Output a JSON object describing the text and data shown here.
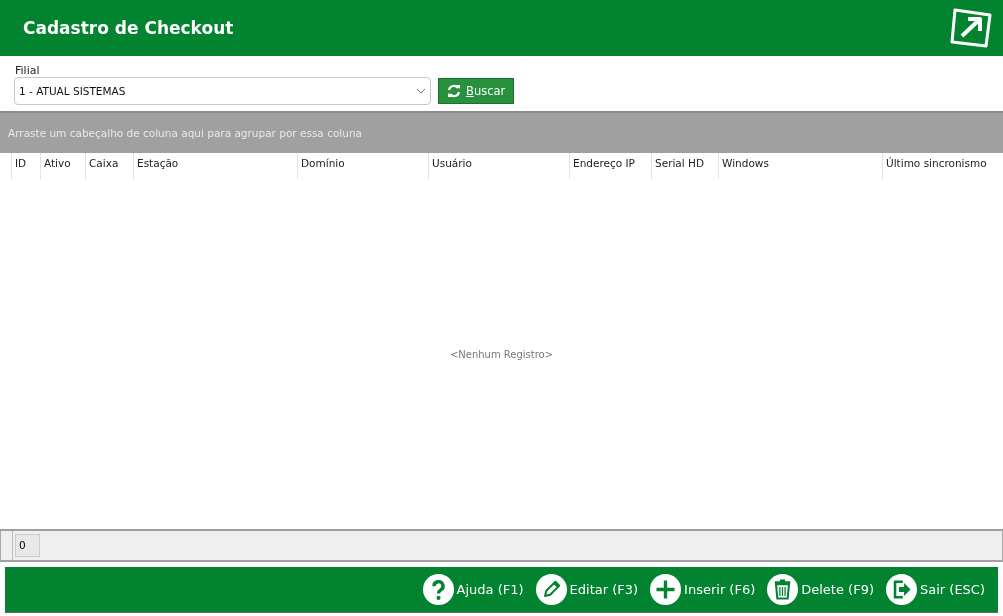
{
  "window": {
    "title": "Cadastro de Checkout"
  },
  "filter": {
    "label": "Filial",
    "value": "1 - ATUAL SISTEMAS",
    "search_button": {
      "label": "Buscar",
      "access_key_underlined": true
    }
  },
  "group_panel": {
    "hint": "Arraste um cabeçalho de coluna aqui para agrupar por essa coluna"
  },
  "table": {
    "columns": [
      "ID",
      "Ativo",
      "Caixa",
      "Estação",
      "Domínio",
      "Usuário",
      "Endereço IP",
      "Serial HD",
      "Windows",
      "Último sincronismo"
    ],
    "empty_text": "<Nenhum Registro>"
  },
  "status_bar": {
    "count": "0"
  },
  "toolbar": [
    {
      "kind": "help",
      "label": "Ajuda (F1)"
    },
    {
      "kind": "edit",
      "label": "Editar (F3)"
    },
    {
      "kind": "insert",
      "label": "Inserir (F6)"
    },
    {
      "kind": "delete",
      "label": "Delete (F9)"
    },
    {
      "kind": "exit",
      "label": "Sair (ESC)"
    }
  ]
}
